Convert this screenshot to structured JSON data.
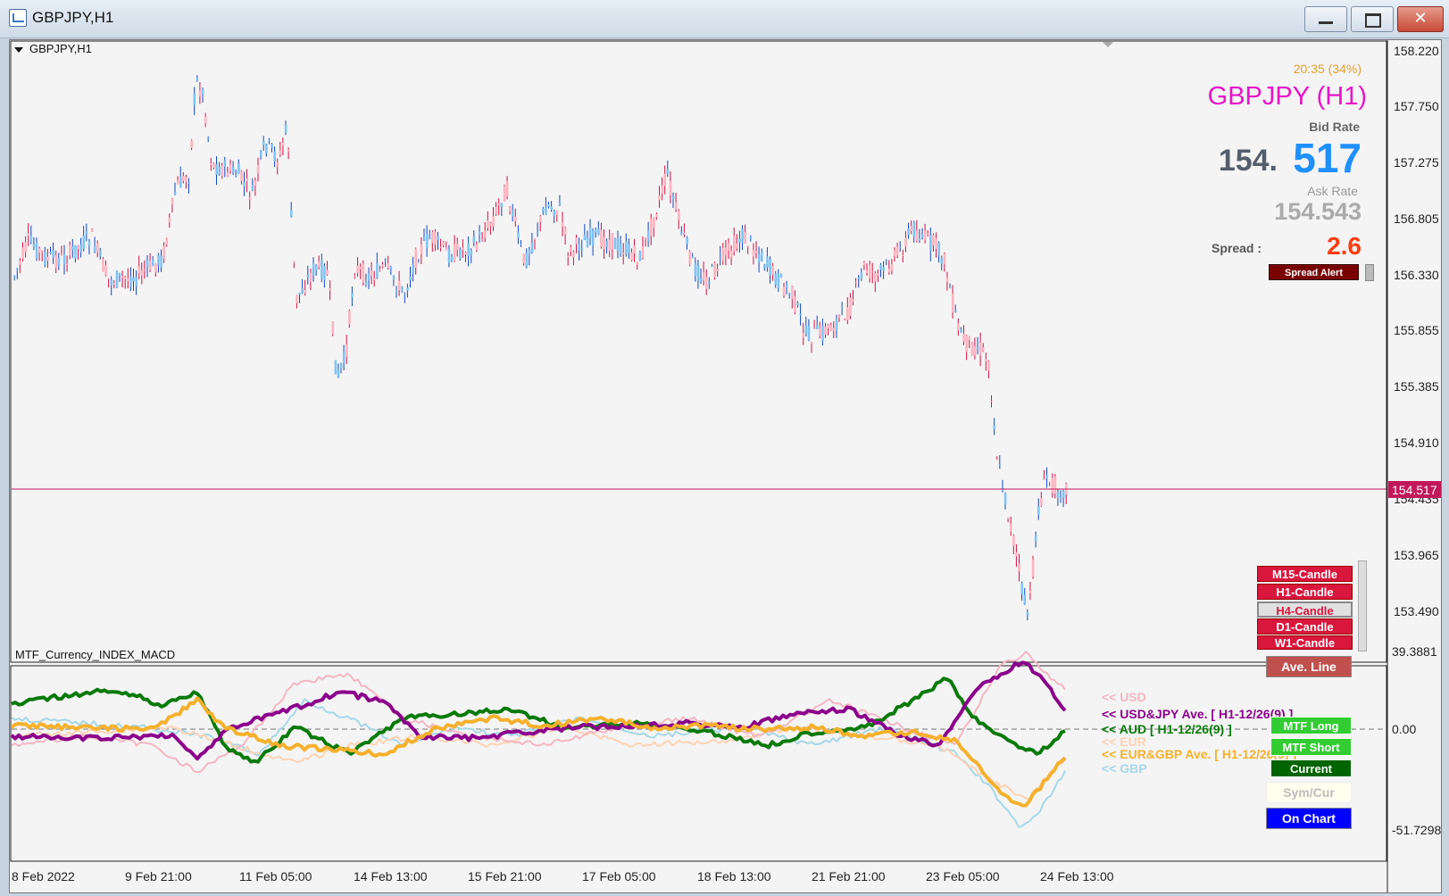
{
  "window": {
    "title": "GBPJPY,H1"
  },
  "main_chart": {
    "label": "GBPJPY,H1",
    "price_labels": [
      "158.220",
      "157.750",
      "157.275",
      "156.805",
      "156.330",
      "155.855",
      "155.385",
      "154.910",
      "154.435",
      "153.965",
      "153.490"
    ],
    "current_price": "154.517",
    "info": {
      "time": "20:35 (34%)",
      "symbol": "GBPJPY (H1)",
      "bid_label": "Bid Rate",
      "bid_int": "154.",
      "bid_frac": "517",
      "ask_label": "Ask Rate",
      "ask": "154.543",
      "spread_label": "Spread  :",
      "spread": "2.6",
      "spread_alert": "Spread Alert"
    },
    "candle_buttons": [
      "M15-Candle",
      "H1-Candle",
      "H4-Candle",
      "D1-Candle",
      "W1-Candle"
    ]
  },
  "sub_chart": {
    "label": "MTF_Currency_INDEX_MACD",
    "max": "39.3881",
    "zero": "0.00",
    "min": "-51.7298",
    "legend": [
      {
        "text": "<< USD",
        "color": "#f4b6c2"
      },
      {
        "text": "<< USD&JPY Ave. [ H1-12/26(9) ]",
        "color": "#8b008b"
      },
      {
        "text": "<< AUD [ H1-12/26(9) ]",
        "color": "#0a7a0a"
      },
      {
        "text": "<< EUR",
        "color": "#ffd2b4"
      },
      {
        "text": "<< EUR&GBP Ave. [ H1-12/26(9) ]",
        "color": "#f5b12e"
      },
      {
        "text": "<< GBP",
        "color": "#a6d8e8"
      }
    ],
    "buttons": {
      "ave_line": "Ave. Line",
      "mtf_long": "MTF Long",
      "mtf_short": "MTF Short",
      "current": "Current",
      "sym_cur": "Sym/Cur",
      "on_chart": "On Chart"
    }
  },
  "time_labels": [
    "8 Feb 2022",
    "9 Feb 21:00",
    "11 Feb 05:00",
    "14 Feb 13:00",
    "15 Feb 21:00",
    "17 Feb 05:00",
    "18 Feb 13:00",
    "21 Feb 21:00",
    "23 Feb 05:00",
    "24 Feb 13:00"
  ],
  "colors": {
    "bull": "#ffb3bf",
    "bear": "#7fc4f5",
    "current_line": "#c2185b",
    "symbol": "#e614c8",
    "bid_frac": "#1e90ff"
  }
}
